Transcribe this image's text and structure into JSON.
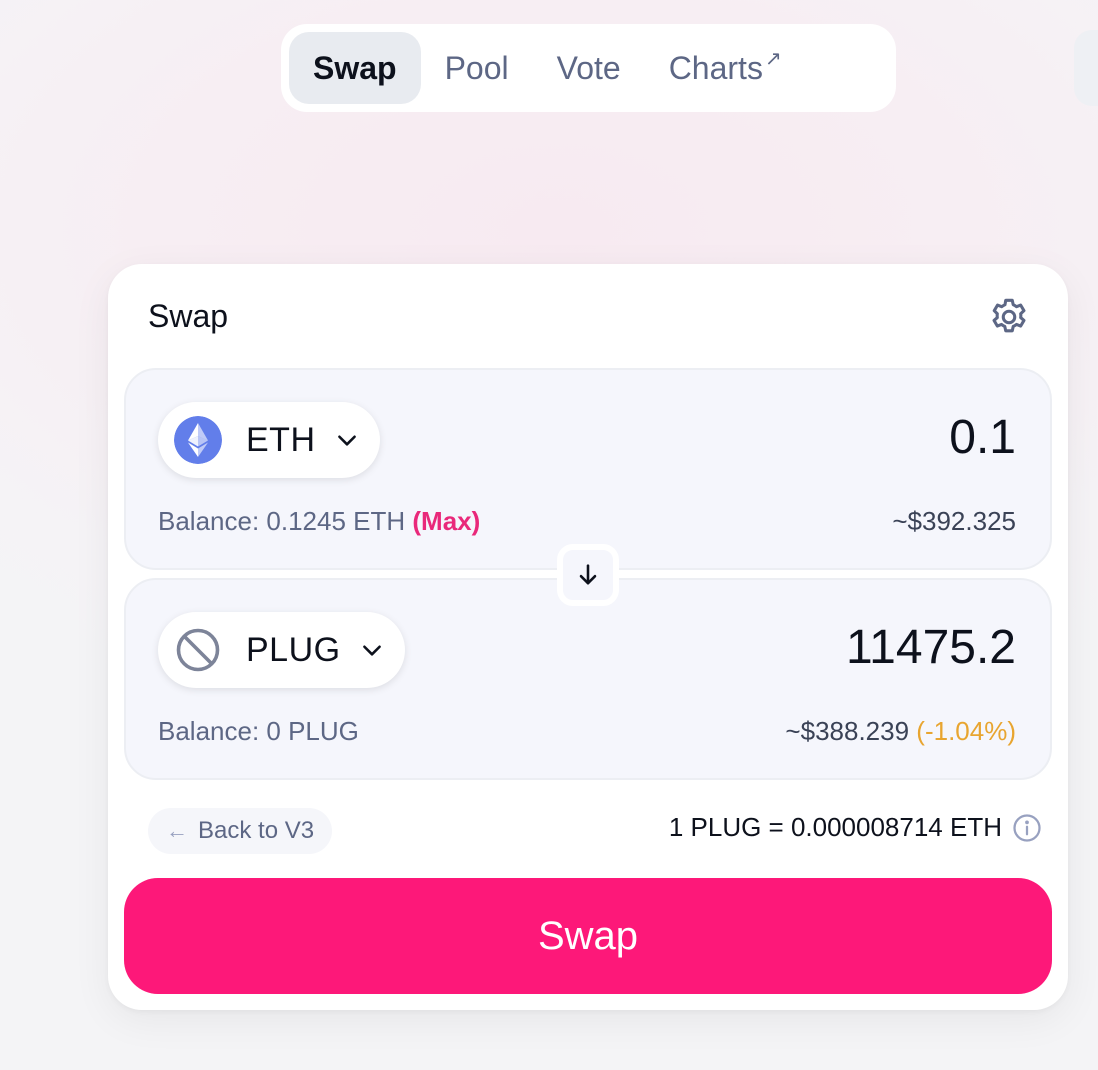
{
  "nav": {
    "items": [
      {
        "label": "Swap",
        "active": true
      },
      {
        "label": "Pool",
        "active": false
      },
      {
        "label": "Vote",
        "active": false
      },
      {
        "label": "Charts",
        "external": true
      }
    ],
    "external_glyph": "↗"
  },
  "card": {
    "title": "Swap",
    "settings_icon": "gear-icon",
    "input": {
      "token": "ETH",
      "amount": "0.1",
      "balance_text": "Balance: 0.1245 ETH",
      "max_label": "(Max)",
      "usd": "~$392.325"
    },
    "output": {
      "token": "PLUG",
      "amount": "11475.2",
      "balance_text": "Balance: 0 PLUG",
      "usd": "~$388.239",
      "price_impact": "(-1.04%)"
    },
    "back_label": "Back to V3",
    "rate": "1 PLUG = 0.000008714 ETH",
    "swap_button": "Swap"
  },
  "colors": {
    "accent": "#fd1879",
    "max": "#e9287a",
    "impact": "#e8a530",
    "eth": "#627eea"
  }
}
